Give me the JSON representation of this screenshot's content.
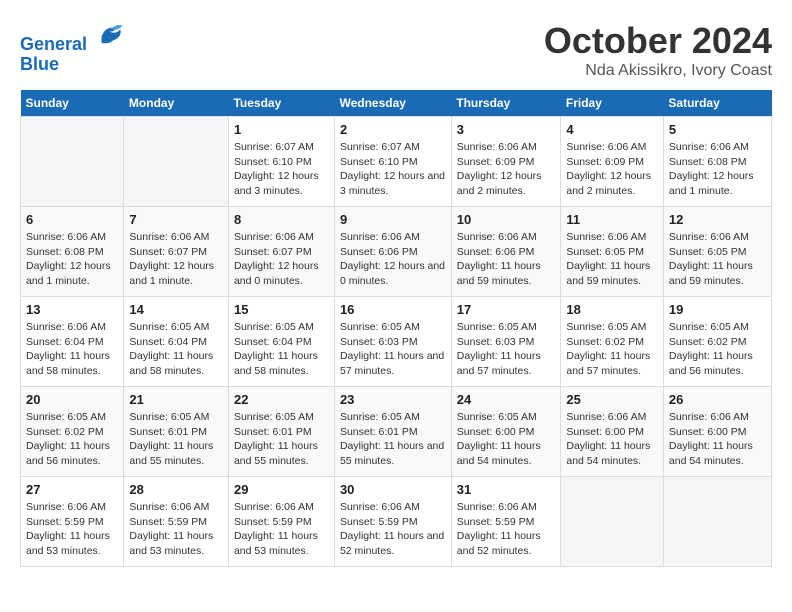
{
  "logo": {
    "line1": "General",
    "line2": "Blue"
  },
  "title": "October 2024",
  "subtitle": "Nda Akissikro, Ivory Coast",
  "days_header": [
    "Sunday",
    "Monday",
    "Tuesday",
    "Wednesday",
    "Thursday",
    "Friday",
    "Saturday"
  ],
  "weeks": [
    [
      {
        "day": "",
        "info": ""
      },
      {
        "day": "",
        "info": ""
      },
      {
        "day": "1",
        "info": "Sunrise: 6:07 AM\nSunset: 6:10 PM\nDaylight: 12 hours and 3 minutes."
      },
      {
        "day": "2",
        "info": "Sunrise: 6:07 AM\nSunset: 6:10 PM\nDaylight: 12 hours and 3 minutes."
      },
      {
        "day": "3",
        "info": "Sunrise: 6:06 AM\nSunset: 6:09 PM\nDaylight: 12 hours and 2 minutes."
      },
      {
        "day": "4",
        "info": "Sunrise: 6:06 AM\nSunset: 6:09 PM\nDaylight: 12 hours and 2 minutes."
      },
      {
        "day": "5",
        "info": "Sunrise: 6:06 AM\nSunset: 6:08 PM\nDaylight: 12 hours and 1 minute."
      }
    ],
    [
      {
        "day": "6",
        "info": "Sunrise: 6:06 AM\nSunset: 6:08 PM\nDaylight: 12 hours and 1 minute."
      },
      {
        "day": "7",
        "info": "Sunrise: 6:06 AM\nSunset: 6:07 PM\nDaylight: 12 hours and 1 minute."
      },
      {
        "day": "8",
        "info": "Sunrise: 6:06 AM\nSunset: 6:07 PM\nDaylight: 12 hours and 0 minutes."
      },
      {
        "day": "9",
        "info": "Sunrise: 6:06 AM\nSunset: 6:06 PM\nDaylight: 12 hours and 0 minutes."
      },
      {
        "day": "10",
        "info": "Sunrise: 6:06 AM\nSunset: 6:06 PM\nDaylight: 11 hours and 59 minutes."
      },
      {
        "day": "11",
        "info": "Sunrise: 6:06 AM\nSunset: 6:05 PM\nDaylight: 11 hours and 59 minutes."
      },
      {
        "day": "12",
        "info": "Sunrise: 6:06 AM\nSunset: 6:05 PM\nDaylight: 11 hours and 59 minutes."
      }
    ],
    [
      {
        "day": "13",
        "info": "Sunrise: 6:06 AM\nSunset: 6:04 PM\nDaylight: 11 hours and 58 minutes."
      },
      {
        "day": "14",
        "info": "Sunrise: 6:05 AM\nSunset: 6:04 PM\nDaylight: 11 hours and 58 minutes."
      },
      {
        "day": "15",
        "info": "Sunrise: 6:05 AM\nSunset: 6:04 PM\nDaylight: 11 hours and 58 minutes."
      },
      {
        "day": "16",
        "info": "Sunrise: 6:05 AM\nSunset: 6:03 PM\nDaylight: 11 hours and 57 minutes."
      },
      {
        "day": "17",
        "info": "Sunrise: 6:05 AM\nSunset: 6:03 PM\nDaylight: 11 hours and 57 minutes."
      },
      {
        "day": "18",
        "info": "Sunrise: 6:05 AM\nSunset: 6:02 PM\nDaylight: 11 hours and 57 minutes."
      },
      {
        "day": "19",
        "info": "Sunrise: 6:05 AM\nSunset: 6:02 PM\nDaylight: 11 hours and 56 minutes."
      }
    ],
    [
      {
        "day": "20",
        "info": "Sunrise: 6:05 AM\nSunset: 6:02 PM\nDaylight: 11 hours and 56 minutes."
      },
      {
        "day": "21",
        "info": "Sunrise: 6:05 AM\nSunset: 6:01 PM\nDaylight: 11 hours and 55 minutes."
      },
      {
        "day": "22",
        "info": "Sunrise: 6:05 AM\nSunset: 6:01 PM\nDaylight: 11 hours and 55 minutes."
      },
      {
        "day": "23",
        "info": "Sunrise: 6:05 AM\nSunset: 6:01 PM\nDaylight: 11 hours and 55 minutes."
      },
      {
        "day": "24",
        "info": "Sunrise: 6:05 AM\nSunset: 6:00 PM\nDaylight: 11 hours and 54 minutes."
      },
      {
        "day": "25",
        "info": "Sunrise: 6:06 AM\nSunset: 6:00 PM\nDaylight: 11 hours and 54 minutes."
      },
      {
        "day": "26",
        "info": "Sunrise: 6:06 AM\nSunset: 6:00 PM\nDaylight: 11 hours and 54 minutes."
      }
    ],
    [
      {
        "day": "27",
        "info": "Sunrise: 6:06 AM\nSunset: 5:59 PM\nDaylight: 11 hours and 53 minutes."
      },
      {
        "day": "28",
        "info": "Sunrise: 6:06 AM\nSunset: 5:59 PM\nDaylight: 11 hours and 53 minutes."
      },
      {
        "day": "29",
        "info": "Sunrise: 6:06 AM\nSunset: 5:59 PM\nDaylight: 11 hours and 53 minutes."
      },
      {
        "day": "30",
        "info": "Sunrise: 6:06 AM\nSunset: 5:59 PM\nDaylight: 11 hours and 52 minutes."
      },
      {
        "day": "31",
        "info": "Sunrise: 6:06 AM\nSunset: 5:59 PM\nDaylight: 11 hours and 52 minutes."
      },
      {
        "day": "",
        "info": ""
      },
      {
        "day": "",
        "info": ""
      }
    ]
  ]
}
